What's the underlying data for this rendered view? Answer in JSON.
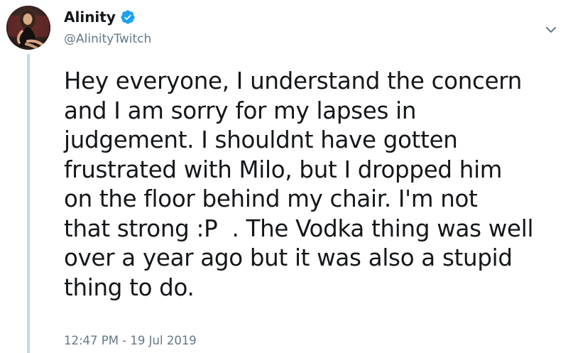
{
  "tweet": {
    "author": {
      "display_name": "Alinity",
      "handle": "@AlinityTwitch",
      "verified_icon": "verified-badge-icon",
      "avatar_icon": "profile-photo"
    },
    "menu_icon": "chevron-down-icon",
    "text_lines": [
      "Hey everyone, I understand the concern",
      "and I am sorry for my lapses in",
      "judgement. I shouldnt have gotten",
      "frustrated with Milo, but I dropped him",
      "on the floor behind my chair. I'm not",
      "that strong :P  . The Vodka thing was well",
      "over a year ago but it was also a stupid",
      "thing to do."
    ],
    "timestamp": "12:47 PM - 19 Jul 2019"
  },
  "colors": {
    "text_primary": "#14171a",
    "text_secondary": "#657786",
    "verified_blue": "#1da1f2",
    "thread_line": "#ccd6dd"
  }
}
